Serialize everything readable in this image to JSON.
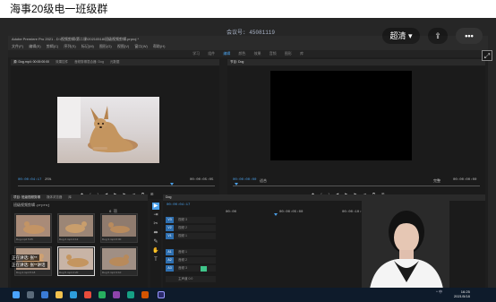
{
  "window": {
    "title": "海事20级电一班级群"
  },
  "meeting": {
    "watermark": "会议号: 45081119",
    "quality_label": "超清",
    "quality_caret": "▾",
    "share_glyph": "⇪",
    "more_glyph": "•••",
    "maximize_glyph": "⤢",
    "overlay_top": "正在讲话: 张**",
    "overlay_bottom": "正在讲话: 张**讲话"
  },
  "premiere": {
    "app_title": "Adobe Premiere Pro 2021 - D:\\视频剪辑\\第二课\\20210518\\班级视频剪辑.prproj *",
    "menu": [
      "文件(F)",
      "编辑(E)",
      "剪辑(C)",
      "序列(S)",
      "标记(M)",
      "图形(G)",
      "视图(V)",
      "窗口(W)",
      "帮助(H)"
    ],
    "workspaces": [
      "学习",
      "组件",
      "编辑",
      "颜色",
      "效果",
      "音频",
      "图形",
      "库"
    ],
    "active_workspace": "编辑",
    "source_tabs": [
      "源: Dog.mp4: 00:00:00:00",
      "效果控件",
      "音频剪辑混合器: Dog",
      "元数据"
    ],
    "program_tabs": [
      "节目: Dog"
    ],
    "source_timecode": "00:00:04:17",
    "source_zoom": "25%",
    "source_duration": "00:00:05:05",
    "program_timecode": "00:00:00:00",
    "program_fit": "适合",
    "program_quality": "完整",
    "program_duration": "00:00:00:00",
    "project_tabs": [
      "项目: 班级视频剪辑",
      "媒体浏览器",
      "库"
    ],
    "project_path": "班级视频剪辑.prproj",
    "project_count": "6 项",
    "thumbnails": [
      {
        "label": "Dog.mp4  5:05"
      },
      {
        "label": "Dog 2.mp4  4:12"
      },
      {
        "label": "Dog 3.mp4  6:00"
      },
      {
        "label": "Dog 4.mp4  5:18"
      },
      {
        "label": "Dog 5.mp4  4:20"
      },
      {
        "label": "Dog 6.mp4  3:10"
      }
    ],
    "timeline_tab": "Dog",
    "timeline_timecode": "00:00:04:17",
    "timeline_ruler": [
      "00:00",
      "00:00:05:00",
      "00:00:10:00",
      "00:00:15:00"
    ],
    "tracks": [
      {
        "tag": "V3",
        "name": "视频 3"
      },
      {
        "tag": "V2",
        "name": "视频 2"
      },
      {
        "tag": "V1",
        "name": "视频 1"
      },
      {
        "tag": "A1",
        "name": "音频 1"
      },
      {
        "tag": "A2",
        "name": "音频 2"
      },
      {
        "tag": "A3",
        "name": "音频 3"
      },
      {
        "tag": "",
        "name": "主声道  0.0"
      }
    ],
    "tools": [
      "▶",
      "⇥",
      "✂",
      "⬌",
      "✎",
      "✋",
      "T"
    ]
  },
  "taskbar": {
    "system": "^ 中",
    "time": "16:25",
    "date": "2021/5/18"
  },
  "colors": {
    "accent": "#4a9fe8",
    "clip": "#3fc58a"
  }
}
